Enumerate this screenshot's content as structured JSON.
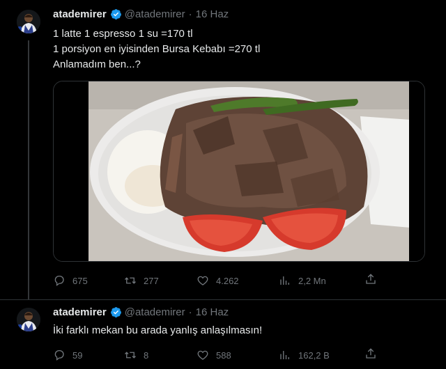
{
  "tweets": [
    {
      "author_name": "atademirer",
      "handle": "@atademirer",
      "separator": "·",
      "date": "16 Haz",
      "lines": [
        "1 latte 1 espresso 1 su =170 tl",
        "1 porsiyon en iyisinden Bursa Kebabı =270 tl",
        "Anlamadım ben...?"
      ],
      "stats": {
        "replies": "675",
        "retweets": "277",
        "likes": "4.262",
        "views": "2,2 Mn"
      }
    },
    {
      "author_name": "atademirer",
      "handle": "@atademirer",
      "separator": "·",
      "date": "16 Haz",
      "lines": [
        "İki farklı mekan bu arada yanlış anlaşılmasın!"
      ],
      "stats": {
        "replies": "59",
        "retweets": "8",
        "likes": "588",
        "views": "162,2 B"
      }
    }
  ],
  "icons": {
    "verified": "verified-badge-icon",
    "reply": "reply-icon",
    "retweet": "retweet-icon",
    "like": "heart-icon",
    "views": "views-chart-icon",
    "share": "share-icon"
  },
  "colors": {
    "background": "#000000",
    "text": "#e7e9ea",
    "muted": "#71767b",
    "verified": "#1d9bf0",
    "border": "#2f3336"
  }
}
